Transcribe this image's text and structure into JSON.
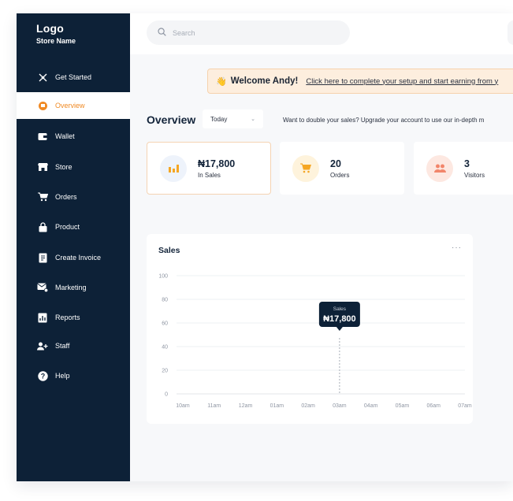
{
  "brand": {
    "logo": "Logo",
    "store_name": "Store Name"
  },
  "sidebar": {
    "items": [
      {
        "label": "Get Started",
        "icon": "get-started-icon"
      },
      {
        "label": "Overview",
        "icon": "overview-icon",
        "active": true
      },
      {
        "label": "Wallet",
        "icon": "wallet-icon"
      },
      {
        "label": "Store",
        "icon": "store-icon"
      },
      {
        "label": "Orders",
        "icon": "cart-icon"
      },
      {
        "label": "Product",
        "icon": "bag-icon"
      },
      {
        "label": "Create Invoice",
        "icon": "invoice-icon"
      },
      {
        "label": "Marketing",
        "icon": "mail-icon"
      },
      {
        "label": "Reports",
        "icon": "reports-icon"
      },
      {
        "label": "Staff",
        "icon": "add-user-icon"
      },
      {
        "label": "Help",
        "icon": "help-icon"
      }
    ]
  },
  "search": {
    "placeholder": "Search"
  },
  "welcome": {
    "emoji": "👋",
    "greeting": "Welcome Andy!",
    "link_text": "Click here to complete your setup and start earning from y"
  },
  "overview": {
    "title": "Overview",
    "period": "Today",
    "upsell": "Want to double your sales? Upgrade your account to use our in-depth m"
  },
  "stats": [
    {
      "value": "₦17,800",
      "label": "In Sales",
      "color": "#eef3fb",
      "icon_color": "#f5a623"
    },
    {
      "value": "20",
      "label": "Orders",
      "color": "#fef3dc",
      "icon_color": "#f5a623"
    },
    {
      "value": "3",
      "label": "Visitors",
      "color": "#fde8e1",
      "icon_color": "#f2866b"
    }
  ],
  "chart": {
    "title": "Sales",
    "more": "···",
    "tooltip": {
      "label": "Sales",
      "value": "₦17,800"
    }
  },
  "chart_data": {
    "type": "line",
    "title": "Sales",
    "x": [
      "10am",
      "11am",
      "12am",
      "01am",
      "02am",
      "03am",
      "04am",
      "05am",
      "06am",
      "07am"
    ],
    "y_ticks": [
      0,
      20,
      40,
      60,
      80,
      100
    ],
    "ylim": [
      0,
      100
    ],
    "highlight_category": "03am",
    "grid": true,
    "series": []
  },
  "colors": {
    "sidebar": "#0d2137",
    "accent": "#f08a24",
    "tooltip": "#0d2137"
  }
}
